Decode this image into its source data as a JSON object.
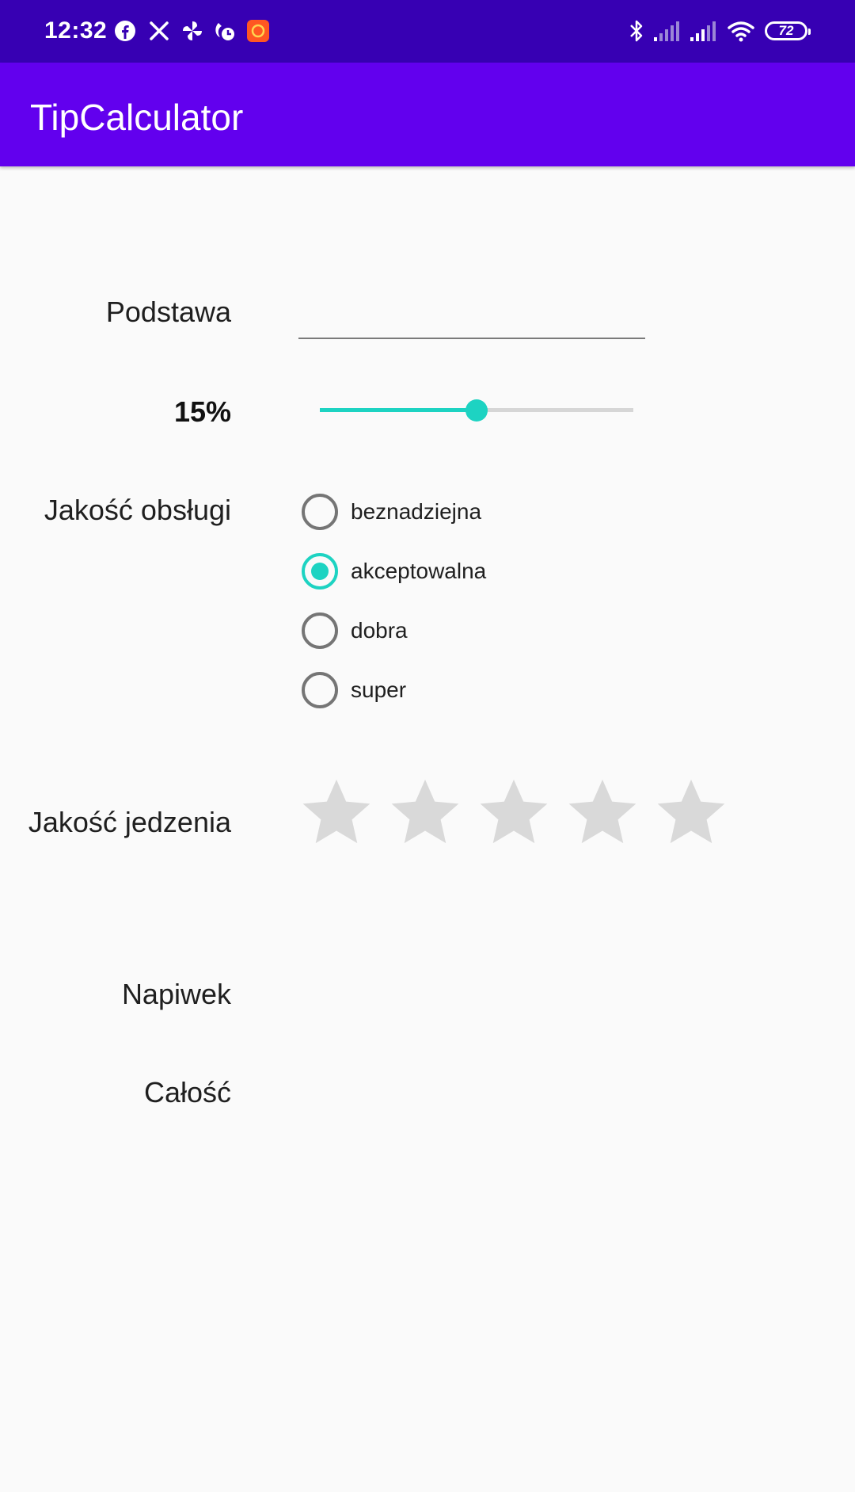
{
  "status_bar": {
    "time": "12:32",
    "battery": "72",
    "left_icons": [
      "facebook-icon",
      "x-icon",
      "pinwheel-icon",
      "app-icon",
      "notification-app-icon"
    ],
    "right_icons": [
      "bluetooth-icon",
      "signal-icon",
      "signal-icon",
      "wifi-icon",
      "battery-icon"
    ]
  },
  "app_bar": {
    "title": "TipCalculator"
  },
  "form": {
    "base_label": "Podstawa",
    "base_value": "",
    "percent_label": "15%",
    "tip_percent_fraction": 0.5,
    "service_label": "Jakość obsługi",
    "service_options": [
      {
        "label": "beznadziejna",
        "checked": false
      },
      {
        "label": "akceptowalna",
        "checked": true
      },
      {
        "label": "dobra",
        "checked": false
      },
      {
        "label": "super",
        "checked": false
      }
    ],
    "food_label": "Jakość jedzenia",
    "food_rating": 0,
    "food_rating_max": 5,
    "tip_label": "Napiwek",
    "tip_value": "",
    "total_label": "Całość",
    "total_value": ""
  },
  "colors": {
    "status_bar": "#3700b3",
    "app_bar": "#6200ee",
    "accent": "#1dd3c2",
    "star_empty": "#d9d9d9",
    "background": "#fafafa"
  }
}
